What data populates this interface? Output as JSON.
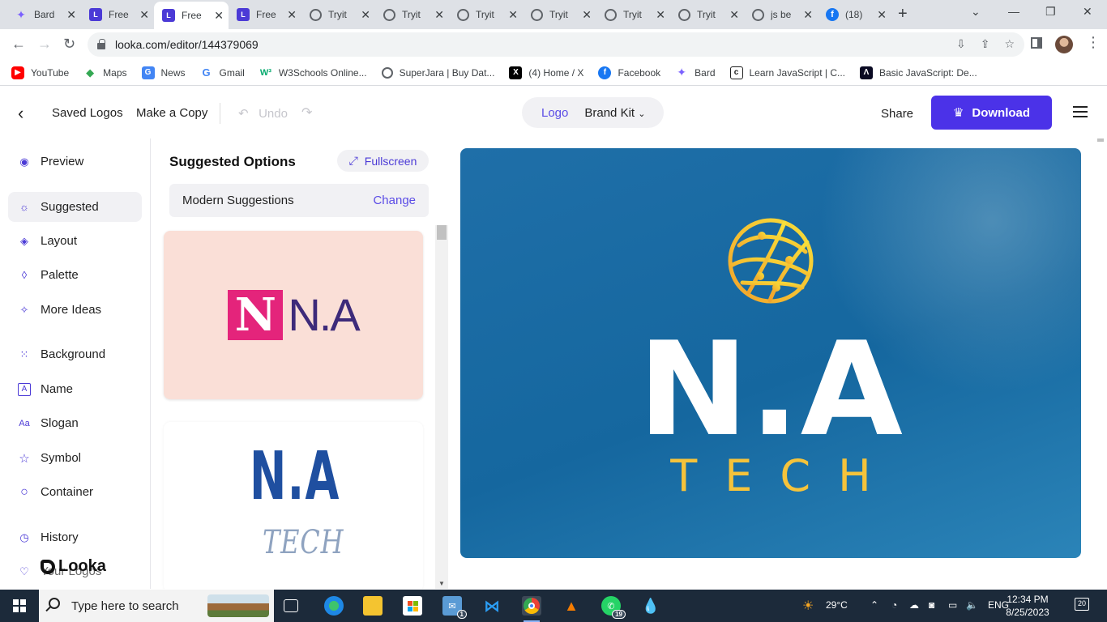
{
  "browser": {
    "tabs": [
      {
        "title": "Bard",
        "icon": "bard-icon"
      },
      {
        "title": "Free",
        "icon": "looka-icon"
      },
      {
        "title": "Free",
        "icon": "looka-icon",
        "active": true
      },
      {
        "title": "Free",
        "icon": "looka-icon"
      },
      {
        "title": "Tryit",
        "icon": "globe-icon"
      },
      {
        "title": "Tryit",
        "icon": "globe-icon"
      },
      {
        "title": "Tryit",
        "icon": "globe-icon"
      },
      {
        "title": "Tryit",
        "icon": "globe-icon"
      },
      {
        "title": "Tryit",
        "icon": "globe-icon"
      },
      {
        "title": "Tryit",
        "icon": "globe-icon"
      },
      {
        "title": "js be",
        "icon": "globe-icon"
      },
      {
        "title": "(18)",
        "icon": "facebook-icon"
      }
    ],
    "url": "looka.com/editor/144379069",
    "bookmarks": [
      {
        "label": "YouTube",
        "icon": "youtube-icon",
        "color": "#ff0000"
      },
      {
        "label": "Maps",
        "icon": "maps-icon",
        "color": "#34a853"
      },
      {
        "label": "News",
        "icon": "news-icon",
        "color": "#4285f4"
      },
      {
        "label": "Gmail",
        "icon": "google-icon",
        "color": "#4285f4"
      },
      {
        "label": "W3Schools Online...",
        "icon": "w3schools-icon",
        "color": "#04aa6d"
      },
      {
        "label": "SuperJara | Buy Dat...",
        "icon": "globe-icon",
        "color": "#5f6368"
      },
      {
        "label": "(4) Home / X",
        "icon": "x-icon",
        "color": "#000000"
      },
      {
        "label": "Facebook",
        "icon": "facebook-icon",
        "color": "#1877f2"
      },
      {
        "label": "Bard",
        "icon": "bard-icon",
        "color": "#7b61ff"
      },
      {
        "label": "Learn JavaScript | C...",
        "icon": "codecademy-icon",
        "color": "#1f1f1f"
      },
      {
        "label": "Basic JavaScript: De...",
        "icon": "freecodecamp-icon",
        "color": "#0a0a23"
      }
    ]
  },
  "header": {
    "saved_logos": "Saved Logos",
    "make_copy": "Make a Copy",
    "undo": "Undo",
    "tab_logo": "Logo",
    "tab_brand_kit": "Brand Kit",
    "share": "Share",
    "download": "Download",
    "accent": "#4b32e8"
  },
  "sidebar": {
    "items": [
      {
        "label": "Preview",
        "icon": "eye-icon"
      },
      {
        "label": "Suggested",
        "icon": "lightbulb-icon",
        "active": true
      },
      {
        "label": "Layout",
        "icon": "layers-icon"
      },
      {
        "label": "Palette",
        "icon": "droplet-icon"
      },
      {
        "label": "More Ideas",
        "icon": "magic-wand-icon"
      },
      {
        "label": "Background",
        "icon": "dotted-grid-icon"
      },
      {
        "label": "Name",
        "icon": "letter-a-box-icon"
      },
      {
        "label": "Slogan",
        "icon": "text-size-icon"
      },
      {
        "label": "Symbol",
        "icon": "star-icon"
      },
      {
        "label": "Container",
        "icon": "circle-icon"
      },
      {
        "label": "History",
        "icon": "clock-icon"
      },
      {
        "label": "Your Logos",
        "icon": "heart-icon"
      }
    ],
    "brand": "Looka"
  },
  "panel": {
    "title": "Suggested Options",
    "fullscreen": "Fullscreen",
    "style_label": "Modern Suggestions",
    "change": "Change",
    "card1": {
      "mark": "N",
      "text": "N.A",
      "bg": "#fadfd7",
      "mark_bg": "#e4247b",
      "text_color": "#3d2a7a"
    },
    "card2": {
      "name": "N.A",
      "slogan": "TECH",
      "name_color": "#1f4fa0",
      "slogan_color": "#8fa3c0"
    }
  },
  "preview": {
    "name": "N.A",
    "slogan": "TECH",
    "bg_color": "#15679f",
    "name_color": "#ffffff",
    "slogan_color": "#f5c33b",
    "symbol": "globe-orbit-icon"
  },
  "taskbar": {
    "search_placeholder": "Type here to search",
    "weather": "29°C",
    "language": "ENG",
    "time": "12:34 PM",
    "date": "8/25/2023",
    "notifications": "20",
    "mail_badge": "1",
    "whatsapp_badge": "19"
  }
}
